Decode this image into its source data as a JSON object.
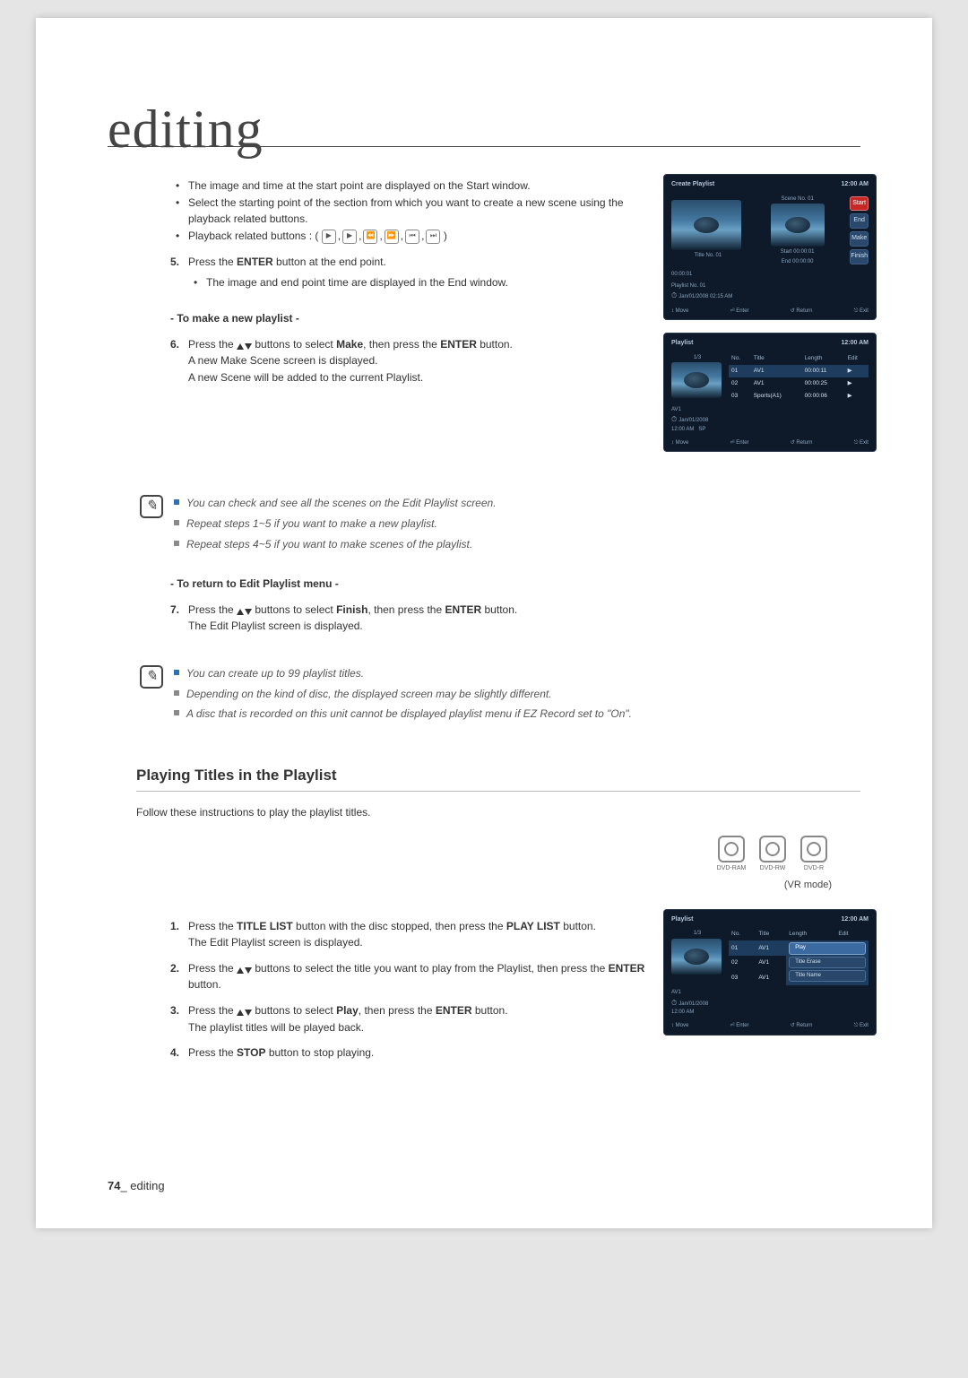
{
  "chapter": {
    "title": "editing"
  },
  "sectionA": {
    "b1": "The image and time at the start point are displayed on the Start window.",
    "b2": "Select the starting point of the section from which you want to create a new scene using the playback related buttons.",
    "b3_pre": "Playback related buttons : (",
    "b3_post": ")"
  },
  "step5": {
    "num": "5.",
    "line1_pre": "Press the ",
    "line1_bold": "ENTER",
    "line1_post": " button at the end point.",
    "b1": "The image and end point time are displayed in the End window."
  },
  "newPlHead": "- To make a new playlist -",
  "step6": {
    "num": "6.",
    "l1_1": "Press the ",
    "l1_2": " buttons to select ",
    "l1_make": "Make",
    "l1_3": ", then press the ",
    "l1_enter": "ENTER",
    "l1_4": " button.",
    "l2": "A new Make Scene screen is displayed.",
    "l3": "A new Scene will be added to the current Playlist."
  },
  "note1": {
    "r1": "You can check and see all the scenes on the Edit Playlist screen.",
    "r2": "Repeat steps 1~5 if you want to make a new playlist.",
    "r3": "Repeat steps 4~5 if you want to make scenes of the playlist."
  },
  "returnHead": "- To return to Edit Playlist menu -",
  "step7": {
    "num": "7.",
    "l1_1": "Press the ",
    "l1_2": " buttons to select ",
    "l1_finish": "Finish",
    "l1_3": ", then press the ",
    "l1_enter": "ENTER",
    "l1_4": " button.",
    "l2": "The Edit Playlist screen is displayed."
  },
  "note2": {
    "r1": "You can create up to 99 playlist titles.",
    "r2": "Depending on the kind of disc, the displayed screen may be slightly different.",
    "r3": "A disc that is recorded on this unit cannot be displayed playlist menu if EZ Record set to \"On\"."
  },
  "playSection": {
    "title": "Playing Titles in the Playlist",
    "intro": "Follow these instructions to play the playlist titles.",
    "modes": [
      "DVD-RAM",
      "DVD-RW",
      "DVD-R"
    ],
    "modeNote": "(VR mode)"
  },
  "step1": {
    "num": "1.",
    "l1_1": "Press the ",
    "l1_b1": "TITLE LIST",
    "l1_2": " button with the disc stopped, then press the ",
    "l1_b2": "PLAY LIST",
    "l1_3": " button.",
    "l2": "The Edit Playlist screen is displayed."
  },
  "step2": {
    "num": "2.",
    "l1_1": "Press the ",
    "l1_2": " buttons to select the title you want to play from the Playlist, then press the ",
    "l1_enter": "ENTER",
    "l1_3": " button."
  },
  "step3": {
    "num": "3.",
    "l1_1": "Press the ",
    "l1_2": " buttons to select ",
    "l1_play": "Play",
    "l1_3": ", then press the ",
    "l1_enter": "ENTER",
    "l1_4": " button.",
    "l2": "The playlist titles will be played back."
  },
  "step4": {
    "num": "4.",
    "l1_1": "Press the ",
    "l1_stop": "STOP",
    "l1_2": " button to stop playing."
  },
  "osd1": {
    "title": "Create Playlist",
    "time": "12:00 AM",
    "sceneLabel": "Scene No. 01",
    "titleLabel": "Title No. 01",
    "tc": "00:00:01",
    "info1": "Playlist No. 01",
    "info2": "Jan/01/2008 02:15 AM",
    "start": "Start 00:00:01",
    "end": "End 00:00:00",
    "btnStart": "Start",
    "btnEnd": "End",
    "btnMake": "Make",
    "btnFinish": "Finish",
    "bMove": "↕ Move",
    "bEnter": "⏎ Enter",
    "bReturn": "↺ Return",
    "bExit": "⎋ Exit"
  },
  "osd2": {
    "title": "Playlist",
    "time": "12:00 AM",
    "count": "1/3",
    "hdNo": "No.",
    "hdTitle": "Title",
    "hdLen": "Length",
    "hdEdit": "Edit",
    "rows": [
      {
        "no": "01",
        "title": "AV1",
        "len": "00:00:11",
        "play": "▶"
      },
      {
        "no": "02",
        "title": "AV1",
        "len": "00:00:25",
        "play": "▶"
      },
      {
        "no": "03",
        "title": "Sports(A1)",
        "len": "00:00:06",
        "play": "▶"
      }
    ],
    "info1": "AV1",
    "info2": "Jan/01/2008",
    "info3": "12:00 AM",
    "sp": "SP",
    "bMove": "↕ Move",
    "bEnter": "⏎ Enter",
    "bReturn": "↺ Return",
    "bExit": "⎋ Exit"
  },
  "osd3": {
    "title": "Playlist",
    "time": "12:00 AM",
    "count": "1/3",
    "hdNo": "No.",
    "hdTitle": "Title",
    "hdLen": "Length",
    "hdEdit": "Edit",
    "rows": [
      {
        "no": "01",
        "title": "AV1"
      },
      {
        "no": "02",
        "title": "AV1"
      },
      {
        "no": "03",
        "title": "AV1"
      }
    ],
    "menu": [
      "Play",
      "Title Erase",
      "Title Name"
    ],
    "info1": "AV1",
    "info2": "Jan/01/2008",
    "info3": "12:00 AM",
    "bMove": "↕ Move",
    "bEnter": "⏎ Enter",
    "bReturn": "↺ Return",
    "bExit": "⎋ Exit"
  },
  "footer": {
    "page": "74",
    "section": "_ editing"
  }
}
